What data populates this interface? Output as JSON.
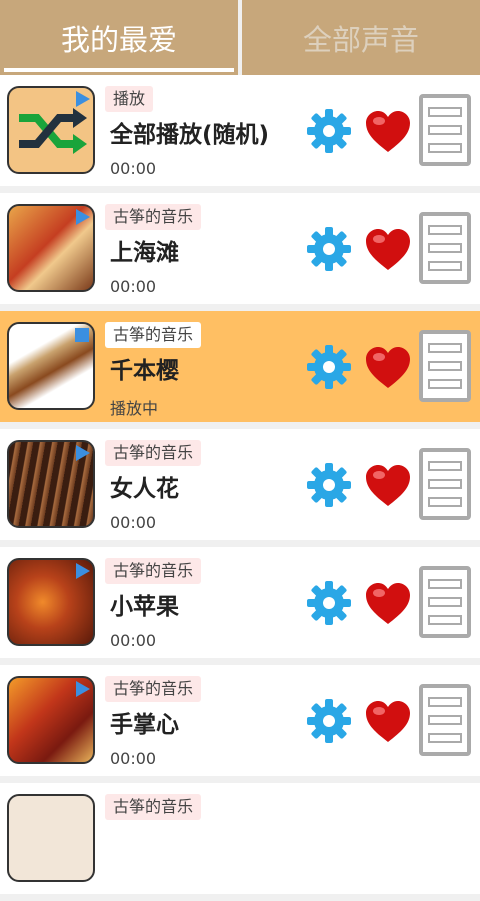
{
  "tabs": {
    "favorites": "我的最爱",
    "all": "全部声音"
  },
  "items": [
    {
      "category": "播放",
      "title": "全部播放(随机)",
      "time": "00:00",
      "thumb": "shuffle-icon",
      "active": false
    },
    {
      "category": "古筝的音乐",
      "title": "上海滩",
      "time": "00:00",
      "thumb": "guzheng-photo",
      "active": false
    },
    {
      "category": "古筝的音乐",
      "title": "千本樱",
      "time": "播放中",
      "thumb": "guzheng-photo",
      "active": true
    },
    {
      "category": "古筝的音乐",
      "title": "女人花",
      "time": "00:00",
      "thumb": "guzheng-photo",
      "active": false
    },
    {
      "category": "古筝的音乐",
      "title": "小苹果",
      "time": "00:00",
      "thumb": "guzheng-photo",
      "active": false
    },
    {
      "category": "古筝的音乐",
      "title": "手掌心",
      "time": "00:00",
      "thumb": "guzheng-photo",
      "active": false
    },
    {
      "category": "古筝的音乐",
      "title": "",
      "time": "",
      "thumb": "guzheng-photo",
      "active": false
    }
  ],
  "colors": {
    "tab_bg": "#c7a77b",
    "active_row": "#ffbf63",
    "gear": "#2aa7e6",
    "heart": "#d10f0f"
  }
}
